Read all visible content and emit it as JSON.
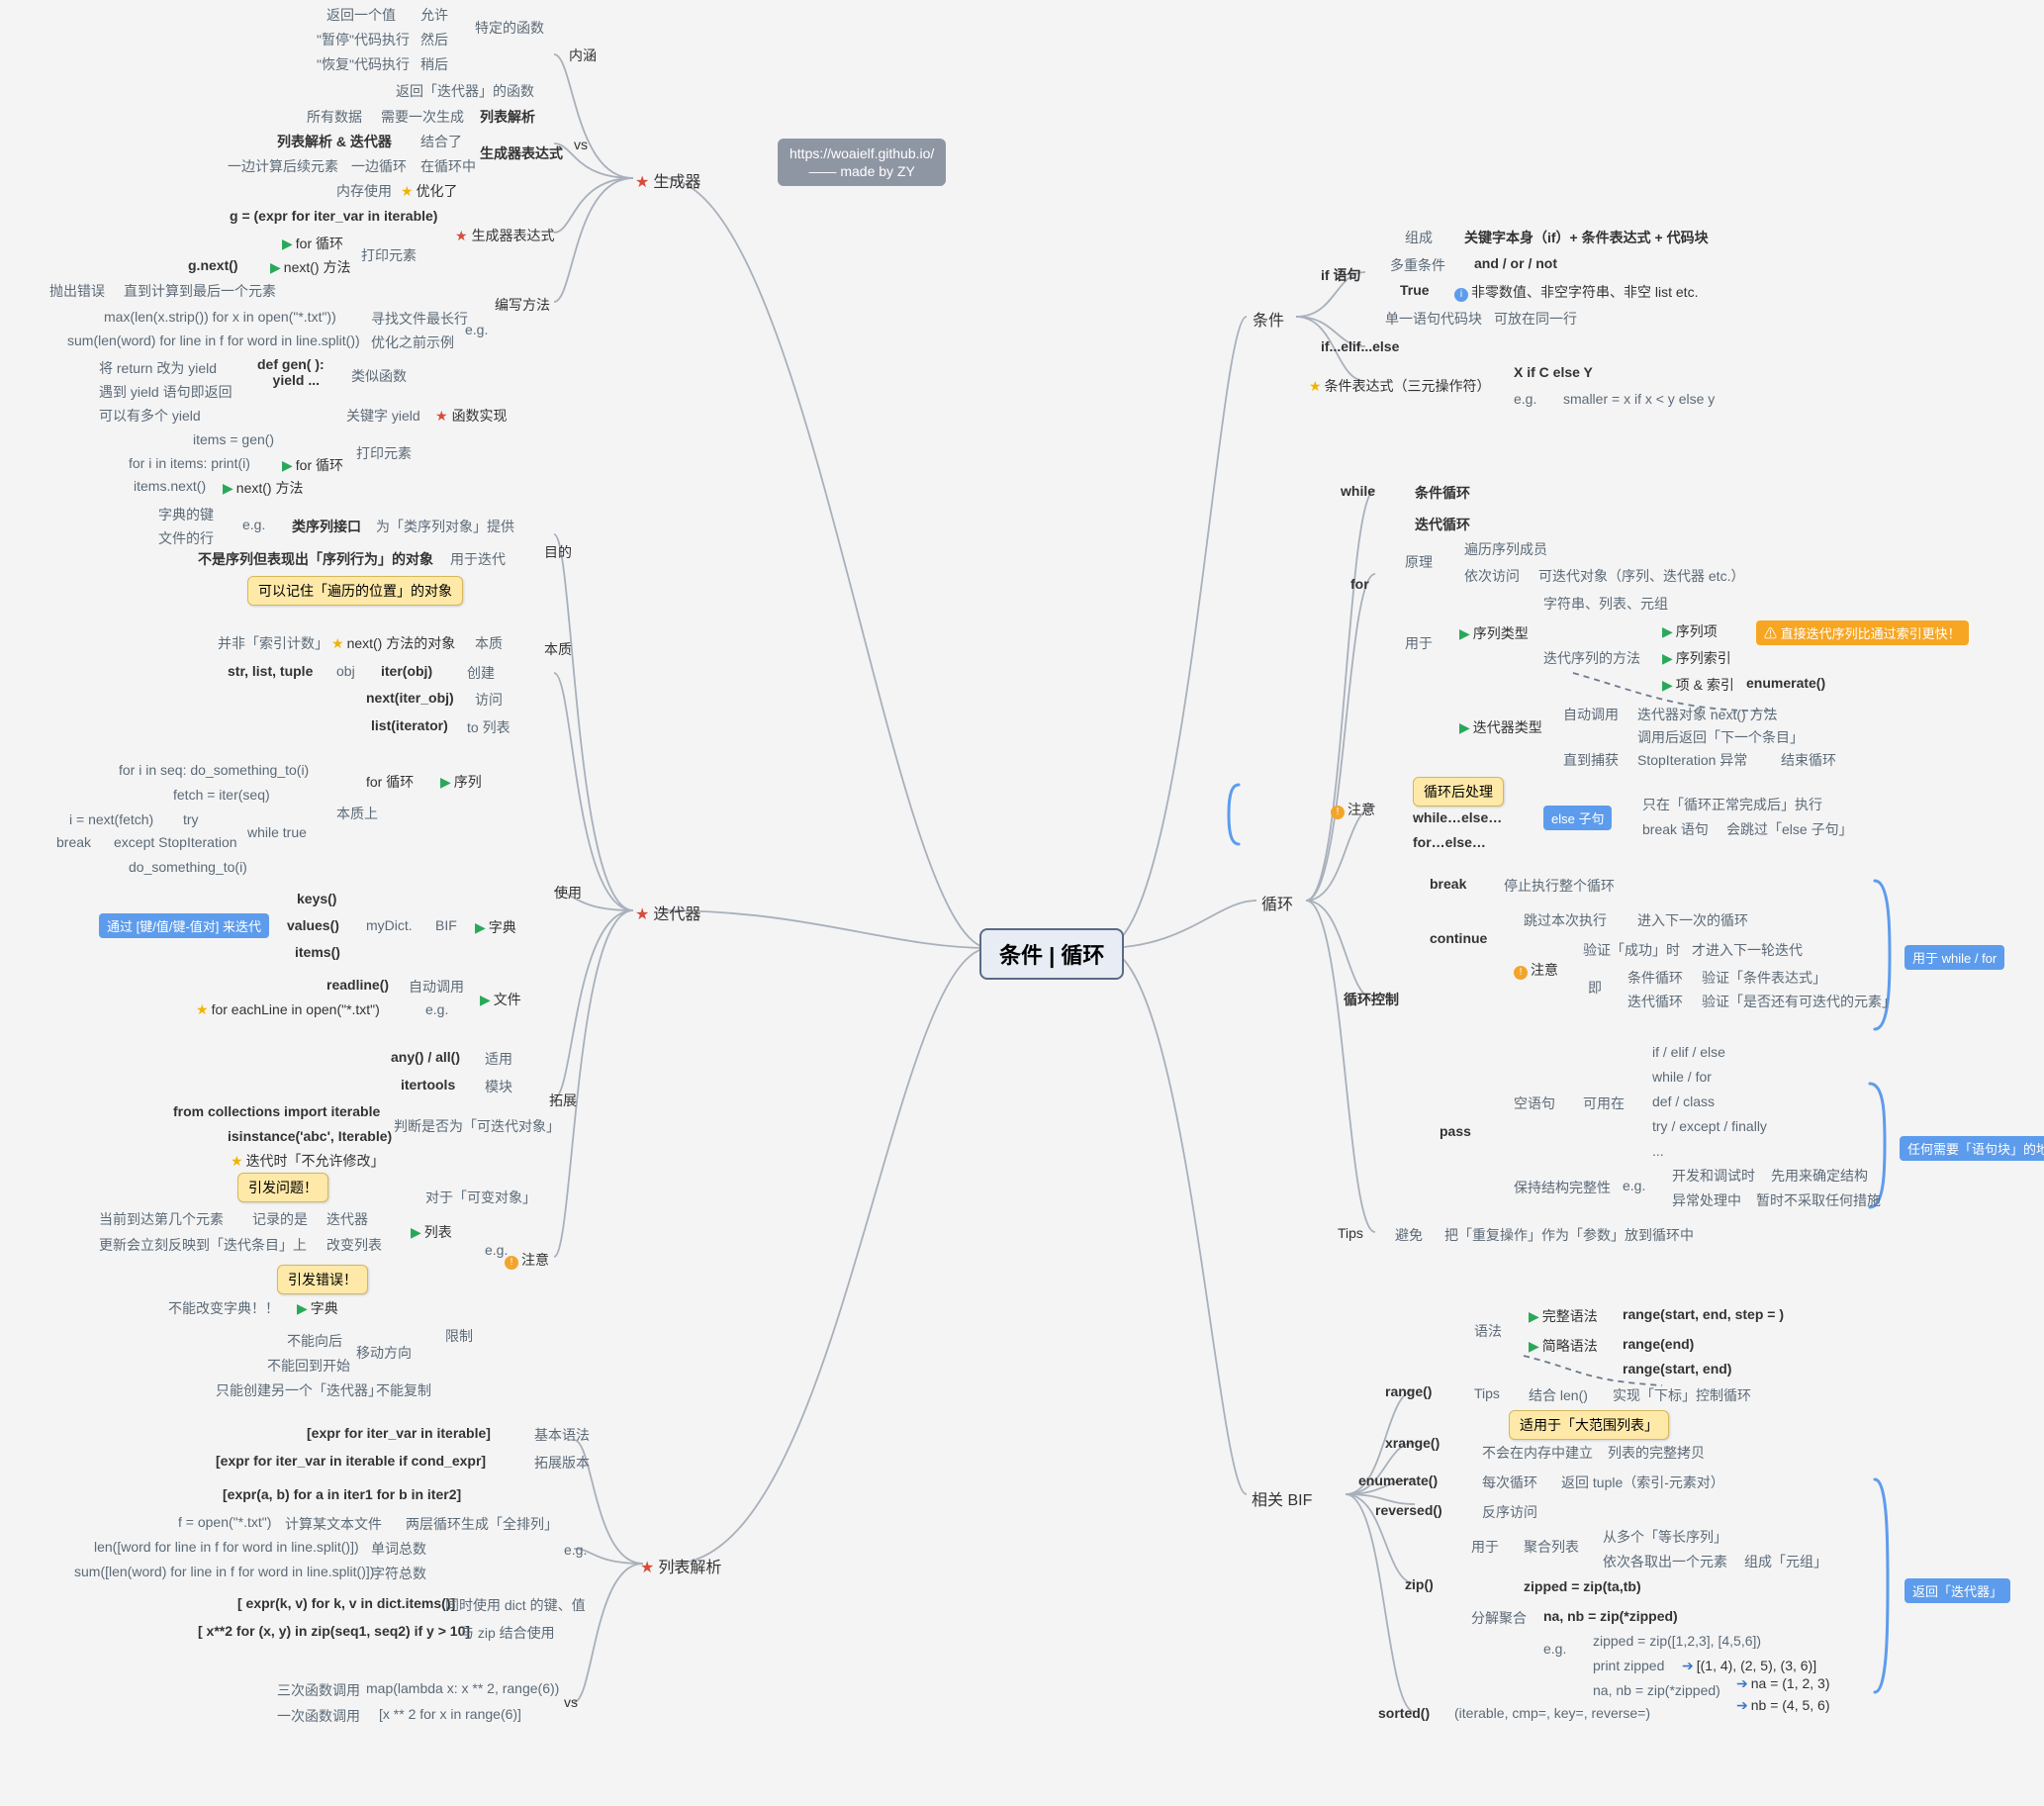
{
  "root": "条件 | 循环",
  "credit_line1": "https://woaielf.github.io/",
  "credit_line2": "—— made by ZY",
  "gen": {
    "title": "生成器",
    "b_inner_loop": "内涵",
    "b_vs": "vs",
    "b_gen_expr": "生成器表达式",
    "b_write": "编写方法",
    "row1a": "返回一个值",
    "row1b": "允许",
    "row2a": "\"暂停\"代码执行",
    "row2b": "然后",
    "row2c": "特定的函数",
    "row3a": "\"恢复\"代码执行",
    "row3b": "稍后",
    "row4": "返回「迭代器」的函数",
    "vs1a": "所有数据",
    "vs1b": "需要一次生成",
    "vs1c": "列表解析",
    "vs2a": "列表解析 & 迭代器",
    "vs2b": "结合了",
    "vs3a": "一边计算后续元素",
    "vs3b": "一边循环",
    "vs3c": "在循环中",
    "vs3d": "生成器表达式",
    "vs4a": "内存使用",
    "vs4b": "优化了",
    "ge1": "g = (expr for iter_var in iterable)",
    "ge2a": "for 循环",
    "ge2b": "打印元素",
    "ge3a": "g.next()",
    "ge3b": "next() 方法",
    "ge4a": "抛出错误",
    "ge4b": "直到计算到最后一个元素",
    "eg1a": "max(len(x.strip()) for x in open(\"*.txt\"))",
    "eg1b": "寻找文件最长行",
    "eg2a": "sum(len(word) for line in f for word in line.split())",
    "eg2b": "优化之前示例",
    "eg_lbl": "e.g.",
    "fn1a": "def gen( ):\n    yield ...",
    "fn1b": "类似函数",
    "fn2a": "将 return 改为 yield",
    "fn2b": "遇到 yield 语句即返回",
    "fn2c": "可以有多个 yield",
    "fn3": "关键字 yield",
    "fn3b": "函数实现",
    "fn4a": "items = gen()",
    "fn4b": "for i in items: print(i)",
    "fn4c": "for 循环",
    "fn4d": "打印元素",
    "fn5a": "items.next()",
    "fn5b": "next() 方法"
  },
  "iter": {
    "title": "迭代器",
    "purpose": "目的",
    "essence": "本质",
    "use": "使用",
    "ext": "拓展",
    "caution": "注意",
    "p_eg": "e.g.",
    "p_eg1": "字典的键",
    "p_eg2": "文件的行",
    "p1": "类序列接口",
    "p1b": "为「类序列对象」提供",
    "p2": "不是序列但表现出「序列行为」的对象",
    "p2b": "用于迭代",
    "p_call": "可以记住「遍历的位置」的对象",
    "e1a": "并非「索引计数」",
    "e1b": "next() 方法的对象",
    "e1c": "本质",
    "e2a": "str, list, tuple",
    "e2b": "obj",
    "e2c": "iter(obj)",
    "e2d": "创建",
    "e3a": "next(iter_obj)",
    "e3b": "访问",
    "e4a": "list(iterator)",
    "e4b": "to 列表",
    "us_for": "for 循环",
    "us_for_flag": "序列",
    "us_ess": "本质上",
    "us1": "for i in seq: do_something_to(i)",
    "us2": "fetch = iter(seq)",
    "us3a": "i = next(fetch)",
    "us3b": "try",
    "us4a": "break",
    "us4b": "except StopIteration",
    "us5": "while true",
    "us6": "do_something_to(i)",
    "dict_bif": "BIF",
    "dict_d": "字典",
    "dict_my": "myDict.",
    "dict_k": "keys()",
    "dict_v": "values()",
    "dict_i": "items()",
    "dict_pill": "通过 [键/值/键-值对] 来迭代",
    "file": "文件",
    "file_r": "readline()",
    "file_a": "自动调用",
    "file_eg": "e.g.",
    "file_fe": "for eachLine in open(\"*.txt\")",
    "ext1": "any() / all()",
    "ext1b": "适用",
    "ext2": "itertools",
    "ext2b": "模块",
    "ext3a": "from collections import iterable",
    "ext3b": "isinstance('abc', Iterable)",
    "ext3c": "判断是否为「可迭代对象」",
    "cau_mut": "对于「可变对象」",
    "cau_eg": "e.g.",
    "cau_list": "列表",
    "cau_listb": "迭代器",
    "cau_listc": "记录的是",
    "cau_listd": "当前到达第几个元素",
    "cau_list2": "改变列表",
    "cau_list2b": "更新会立刻反映到「迭代条目」上",
    "cau_dict": "字典",
    "cau_dictb": "不能改变字典！！",
    "cau_c1": "引发问题！",
    "cau_c1b": "迭代时「不允许修改」",
    "cau_c2": "引发错误！",
    "lim": "限制",
    "lim1": "不能向后",
    "lim1b": "移动方向",
    "lim2": "不能回到开始",
    "lim3": "只能创建另一个「迭代器」",
    "lim3b": "不能复制"
  },
  "lc": {
    "title": "列表解析",
    "s1": "[expr for iter_var in iterable]",
    "s1b": "基本语法",
    "s2": "[expr for iter_var in iterable if cond_expr]",
    "s2b": "拓展版本",
    "eg": "e.g.",
    "n1": "[expr(a, b) for a in iter1 for b in iter2]",
    "n1b": "两层循环生成「全排列」",
    "n2a": "f = open(\"*.txt\")",
    "n2b": "计算某文本文件",
    "n3a": "len([word for line in f for word in line.split()])",
    "n3b": "单词总数",
    "n4a": "sum([len(word) for line in f for word in line.split()])",
    "n4b": "字符总数",
    "n5": "[ expr(k, v) for k, v in dict.items()]",
    "n5b": "同时使用 dict 的键、值",
    "n6": "[ x**2 for (x, y) in zip(seq1, seq2) if y > 10]",
    "n6b": "与 zip 结合使用",
    "vs": "vs",
    "vs1a": "三次函数调用",
    "vs1b": "map(lambda x: x ** 2, range(6))",
    "vs2a": "一次函数调用",
    "vs2b": "[x ** 2 for x in range(6)]"
  },
  "cond": {
    "title": "条件",
    "if": "if 语句",
    "ife": "if...elif...else",
    "ce": "条件表达式（三元操作符）",
    "c1a": "组成",
    "c1b": "关键字本身（if）+ 条件表达式 + 代码块",
    "c2a": "多重条件",
    "c2b": "and / or / not",
    "c3a": "True",
    "c3b": "非零数值、非空字符串、非空 list etc.",
    "c4a": "单一语句代码块",
    "c4b": "可放在同一行",
    "ce1": "X if C else Y",
    "ce2": "e.g.",
    "ce2b": "smaller = x if x < y else y"
  },
  "loop": {
    "title": "循环",
    "while": "while",
    "while_b": "条件循环",
    "for": "for",
    "for_b": "迭代循环",
    "pr": "原理",
    "pr1": "遍历序列成员",
    "pr2": "依次访问",
    "pr2b": "可迭代对象（序列、迭代器 etc.）",
    "uf": "用于",
    "uf1": "序列类型",
    "uf1b": "字符串、列表、元组",
    "uf2a": "序列项",
    "uf2b": "序列索引",
    "uf2c": "项 & 索引",
    "uf2d": "迭代序列的方法",
    "uf2e": "enumerate()",
    "uf_pill": "直接迭代序列比通过索引更快！",
    "it": "迭代器类型",
    "it1": "自动调用",
    "it1b": "迭代器对象 next() 方法",
    "it1c": "调用后返回「下一个条目」",
    "it2": "直到捕获",
    "it2b": "StopIteration 异常",
    "it2c": "结束循环",
    "cau_lbl": "注意",
    "cau_call": "循环后处理",
    "we": "while…else…",
    "fe": "for…else…",
    "we1": "else 子句",
    "we2": "只在「循环正常完成后」执行",
    "we3": "break 语句",
    "we3b": "会跳过「else 子句」",
    "ctrl": "循环控制",
    "brk": "break",
    "brk_b": "停止执行整个循环",
    "cont": "continue",
    "cont_b": "跳过本次执行",
    "cont_c": "进入下一次的循环",
    "cont_n": "注意",
    "cont_n1": "验证「成功」时",
    "cont_n1b": "才进入下一轮迭代",
    "cont_n2": "即",
    "cont_n2a": "条件循环",
    "cont_n2b": "验证「条件表达式」",
    "cont_n3a": "迭代循环",
    "cont_n3b": "验证「是否还有可迭代的元素」",
    "pass": "pass",
    "pass1": "空语句",
    "pass2": "可用在",
    "pass2a": "if / elif / else",
    "pass2b": "while / for",
    "pass2c": "def / class",
    "pass2d": "try / except / finally",
    "pass2e": "...",
    "pass3": "保持结构完整性",
    "pass3b": "e.g.",
    "pass3c": "开发和调试时",
    "pass3d": "先用来确定结构",
    "pass3e": "异常处理中",
    "pass3f": "暂时不采取任何措施",
    "brkt1": "用于 while / for",
    "brkt2": "任何需要「语句块」的地方",
    "tips": "Tips",
    "tips1": "避免",
    "tips2": "把「重复操作」作为「参数」放到循环中"
  },
  "bif": {
    "title": "相关 BIF",
    "range": "range()",
    "xrange": "xrange()",
    "enum": "enumerate()",
    "rev": "reversed()",
    "zip": "zip()",
    "sorted": "sorted()",
    "r1": "语法",
    "r1a": "完整语法",
    "r1b": "range(start, end, step = )",
    "r2a": "简略语法",
    "r2b": "range(end)",
    "r2c": "range(start, end)",
    "r3": "Tips",
    "r3a": "结合 len()",
    "r3b": "实现「下标」控制循环",
    "r_call": "适用于「大范围列表」",
    "x1": "不会在内存中建立",
    "x2": "列表的完整拷贝",
    "en1": "每次循环",
    "en2": "返回 tuple（索引-元素对）",
    "rv1": "反序访问",
    "z_u": "用于",
    "z_u1": "聚合列表",
    "z_u2": "从多个「等长序列」",
    "z_u3": "依次各取出一个元素",
    "z_u4": "组成「元组」",
    "z1": "zipped = zip(ta,tb)",
    "z_d": "分解聚合",
    "z2": "na, nb = zip(*zipped)",
    "z_eg": "e.g.",
    "z3a": "zipped = zip([1,2,3], [4,5,6])",
    "z3b": "print zipped",
    "z3c": "[(1, 4), (2, 5), (3, 6)]",
    "z4a": "na, nb = zip(*zipped)",
    "z4b": "na = (1, 2, 3)",
    "z4c": "nb = (4, 5, 6)",
    "s1": "(iterable, cmp=, key=, reverse=)",
    "brkt": "返回「迭代器」"
  }
}
